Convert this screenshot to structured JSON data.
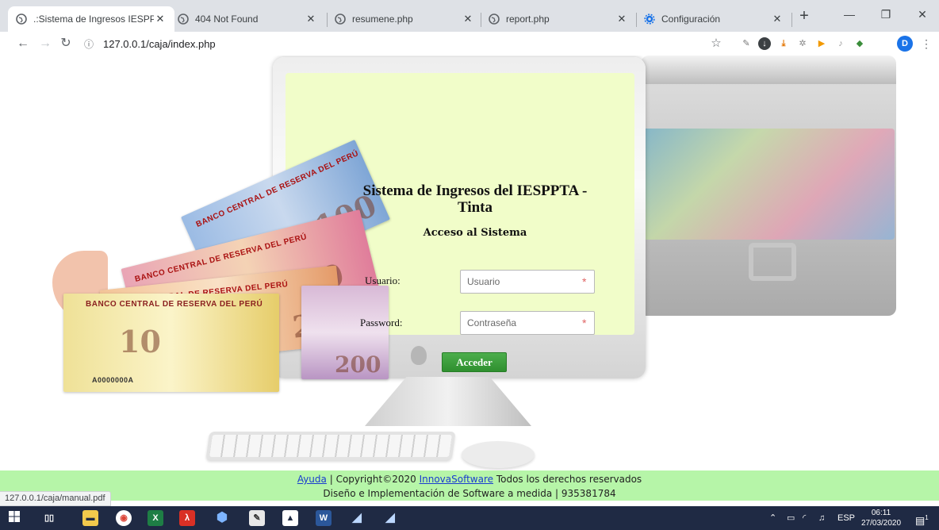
{
  "browser": {
    "tabs": [
      {
        "title": ".:Sistema de Ingresos IESPPTA",
        "active": true
      },
      {
        "title": "404 Not Found",
        "active": false
      },
      {
        "title": "resumene.php",
        "active": false
      },
      {
        "title": "report.php",
        "active": false
      },
      {
        "title": "Configuración",
        "active": false
      }
    ],
    "url": "127.0.0.1/caja/index.php",
    "profile_initial": "D"
  },
  "banknotes": {
    "bank_name": "BANCO CENTRAL DE RESERVA DEL PERÚ",
    "serial": "A0000000A",
    "values": [
      "100",
      "50",
      "20",
      "200",
      "10"
    ]
  },
  "login": {
    "title": "Sistema de Ingresos del IESPPTA - Tinta",
    "subtitle": "Acceso al Sistema",
    "user_label": "Usuario:",
    "user_placeholder": "Usuario",
    "password_label": "Password:",
    "password_placeholder": "Contraseña",
    "required_mark": "*",
    "submit_label": "Acceder"
  },
  "footer": {
    "help_link": "Ayuda",
    "copyright": " | Copyright©2020 ",
    "company_link": "InnovaSoftware",
    "rights": " Todos los derechos reservados",
    "line2": "Diseño e Implementación de Software a medida | 935381784"
  },
  "status_bar_url": "127.0.0.1/caja/manual.pdf",
  "taskbar": {
    "language": "ESP",
    "time": "06:11",
    "date": "27/03/2020",
    "notification_count": "1"
  },
  "colors": {
    "screen_bg": "#f1fdc9",
    "footer_bg": "#b6f5a8",
    "button_green": "#3d9e3d",
    "link_blue": "#1a3ccf",
    "required_red": "#e06464"
  }
}
